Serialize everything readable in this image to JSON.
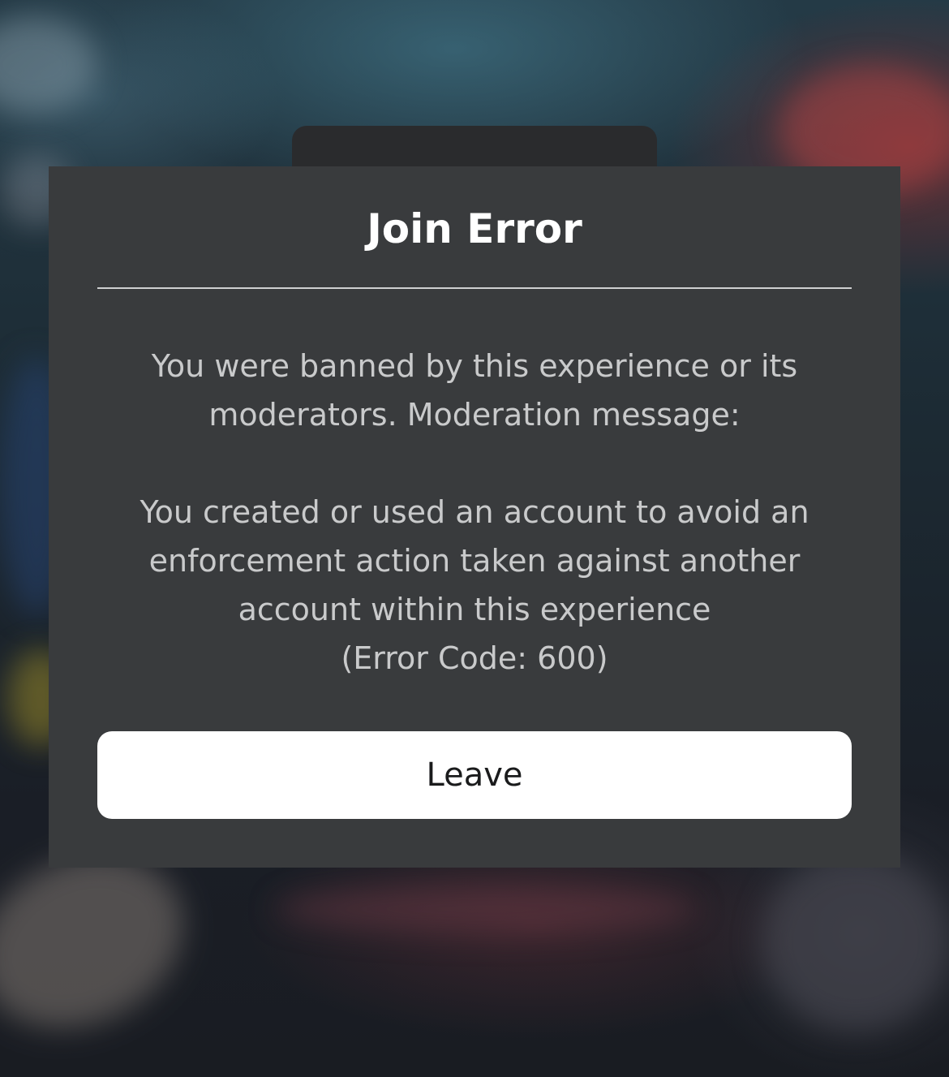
{
  "dialog": {
    "title": "Join Error",
    "message_ban": "You were banned by this experience or its\nmoderators. Moderation message:",
    "message_reason": "You created or used an account to avoid an\nenforcement action taken against another\naccount within this experience",
    "message_code": "(Error Code: 600)",
    "leave_label": "Leave"
  },
  "colors": {
    "dialog_background": "#393b3d",
    "title_text": "#ffffff",
    "body_text": "#c9cacb",
    "button_background": "#ffffff",
    "button_text": "#1a1b1c"
  }
}
